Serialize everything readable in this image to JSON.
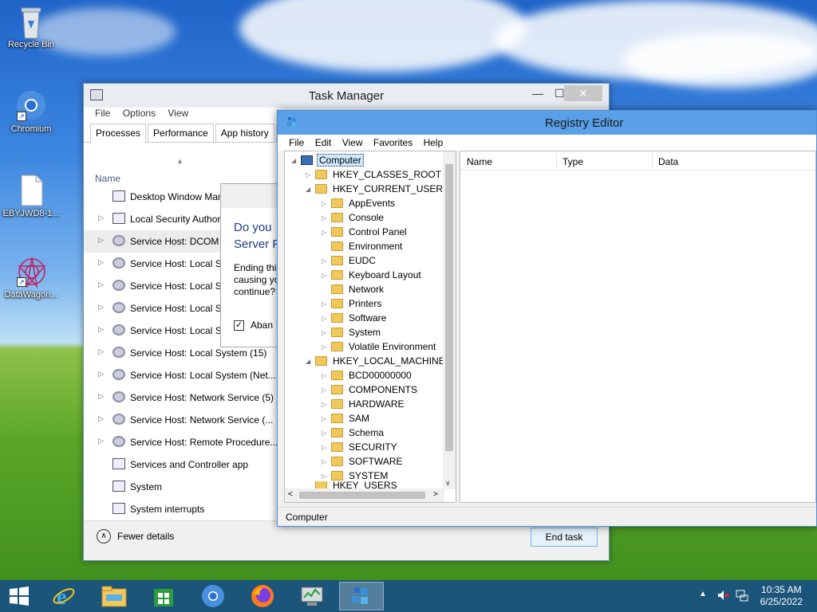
{
  "desktop": {
    "icons": [
      {
        "label": "Recycle Bin"
      },
      {
        "label": "Chromium"
      },
      {
        "label": "EBYJWD8-1..."
      },
      {
        "label": "DataWagon..."
      }
    ]
  },
  "task_manager": {
    "title": "Task Manager",
    "menu": [
      "File",
      "Options",
      "View"
    ],
    "tabs": [
      "Processes",
      "Performance",
      "App history",
      "St"
    ],
    "column_name": "Name",
    "rows": [
      "Desktop Window Man",
      "Local Security Author",
      "Service Host: DCOM S",
      "Service Host: Local Se",
      "Service Host: Local Se",
      "Service Host: Local Se",
      "Service Host: Local Se",
      "Service Host: Local System (15)",
      "Service Host: Local System (Net...",
      "Service Host: Network Service (5)",
      "Service Host: Network Service (...",
      "Service Host: Remote Procedure...",
      "Services and Controller app",
      "System",
      "System interrupts"
    ],
    "fewer_details": "Fewer details",
    "end_task": "End task"
  },
  "dialog": {
    "question_line1": "Do you",
    "question_line2": "Server P",
    "body_line1": "Ending thi",
    "body_line2": "causing yo",
    "body_line3": "continue?",
    "checkbox_label": "Aban",
    "checkbox_mark": "✓"
  },
  "registry_editor": {
    "title": "Registry Editor",
    "menu": [
      "File",
      "Edit",
      "View",
      "Favorites",
      "Help"
    ],
    "tree": {
      "root": "Computer",
      "hkcr": "HKEY_CLASSES_ROOT",
      "hkcu": "HKEY_CURRENT_USER",
      "hkcu_children": [
        "AppEvents",
        "Console",
        "Control Panel",
        "Environment",
        "EUDC",
        "Keyboard Layout",
        "Network",
        "Printers",
        "Software",
        "System",
        "Volatile Environment"
      ],
      "hklm": "HKEY_LOCAL_MACHINE",
      "hklm_children": [
        "BCD00000000",
        "COMPONENTS",
        "HARDWARE",
        "SAM",
        "Schema",
        "SECURITY",
        "SOFTWARE",
        "SYSTEM"
      ],
      "hku": "HKEY_USERS"
    },
    "columns": [
      "Name",
      "Type",
      "Data"
    ],
    "status": "Computer"
  },
  "taskbar": {
    "time": "10:35 AM",
    "date": "6/25/2022"
  }
}
